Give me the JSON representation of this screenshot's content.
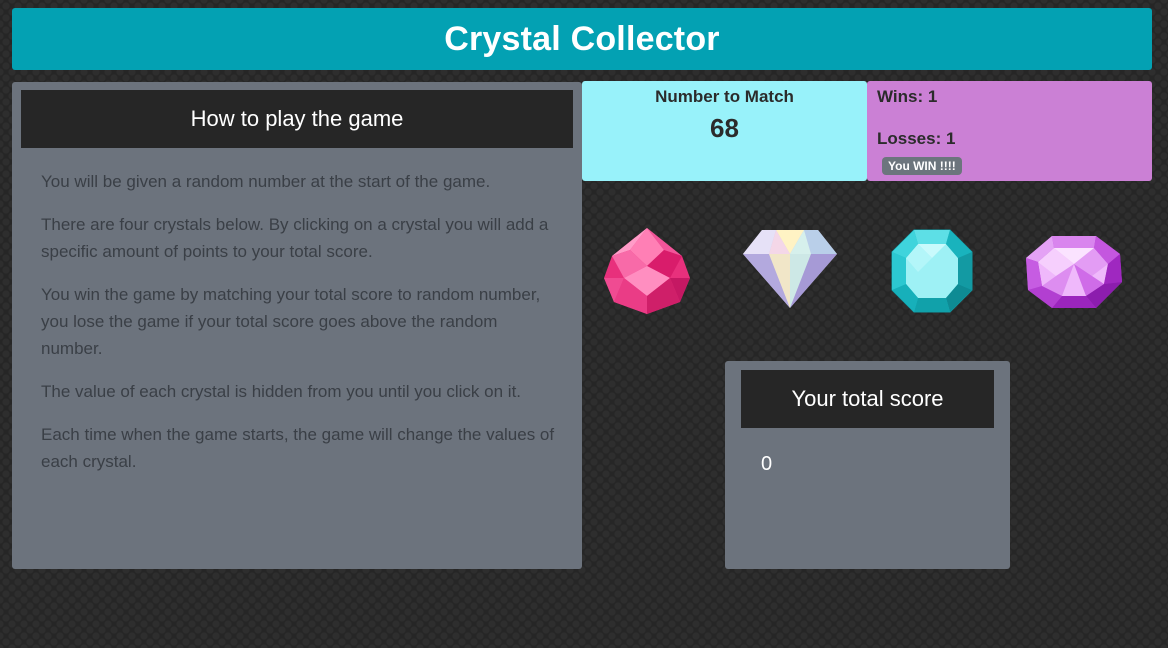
{
  "header": {
    "title": "Crystal Collector"
  },
  "instructions": {
    "heading": "How to play the game",
    "paragraphs": [
      "You will be given a random number at the start of the game.",
      "There are four crystals below. By clicking on a crystal you will add a specific amount of points to your total score.",
      "You win the game by matching your total score to random number, you lose the game if your total score goes above the random number.",
      "The value of each crystal is hidden from you until you click on it.",
      "Each time when the game starts, the game will change the values of each crystal."
    ]
  },
  "target": {
    "label": "Number to Match",
    "value": "68"
  },
  "stats": {
    "wins": "Wins: 1",
    "losses": "Losses: 1",
    "status": "You WIN !!!!"
  },
  "crystals": [
    {
      "name": "pink-crystal",
      "color": "#f0418c"
    },
    {
      "name": "white-diamond",
      "color": "#d9d4f2"
    },
    {
      "name": "teal-crystal",
      "color": "#2fd0d8"
    },
    {
      "name": "purple-crystal",
      "color": "#c24be0"
    }
  ],
  "score": {
    "heading": "Your total score",
    "value": "0"
  },
  "colors": {
    "header": "#03a1b3",
    "panel": "#6c737d",
    "match_box": "#98f2fa",
    "stats_box": "#cb80d5"
  }
}
